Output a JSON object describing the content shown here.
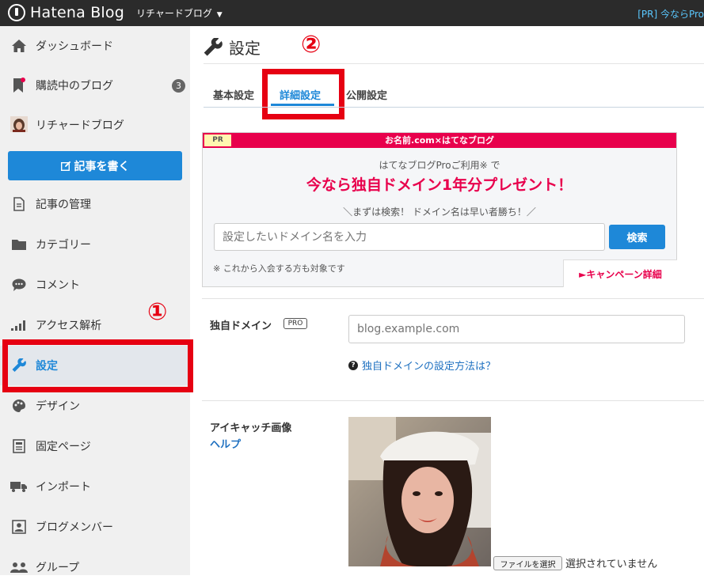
{
  "header": {
    "logo_text": "Hatena Blog",
    "blog_switch": "リチャードブログ",
    "pr_text": "[PR] 今ならPro"
  },
  "sidebar": {
    "items": [
      {
        "label": "ダッシュボード",
        "icon": "home-icon"
      },
      {
        "label": "購読中のブログ",
        "icon": "bookmark-icon",
        "badge": "3"
      },
      {
        "label": "リチャードブログ",
        "icon": "avatar"
      },
      {
        "label": "記事の管理",
        "icon": "document-icon"
      },
      {
        "label": "カテゴリー",
        "icon": "folder-icon"
      },
      {
        "label": "コメント",
        "icon": "comment-icon"
      },
      {
        "label": "アクセス解析",
        "icon": "signal-icon"
      },
      {
        "label": "設定",
        "icon": "wrench-icon"
      },
      {
        "label": "デザイン",
        "icon": "palette-icon"
      },
      {
        "label": "固定ページ",
        "icon": "page-icon"
      },
      {
        "label": "インポート",
        "icon": "truck-icon"
      },
      {
        "label": "ブログメンバー",
        "icon": "member-icon"
      },
      {
        "label": "グループ",
        "icon": "group-icon"
      }
    ],
    "write_button": "記事を書く"
  },
  "annotations": {
    "marker1": "①",
    "marker2": "②"
  },
  "main": {
    "title": "設定",
    "tabs": [
      {
        "label": "基本設定"
      },
      {
        "label": "詳細設定",
        "active": true
      },
      {
        "label": "公開設定"
      }
    ],
    "pr": {
      "tag": "PR",
      "header": "お名前.com×はてなブログ",
      "sub": "はてなブログProご利用※ で",
      "headline": "今なら独自ドメイン1年分プレゼント！",
      "catch": "＼まずは検索！ ドメイン名は早い者勝ち！／",
      "input_placeholder": "設定したいドメイン名を入力",
      "search_button": "検索",
      "note": "※ これから入会する方も対象です",
      "campaign_button": "►キャンペーン詳細"
    },
    "custom_domain": {
      "label": "独自ドメイン",
      "badge": "PRO",
      "placeholder": "blog.example.com",
      "help_link": "独自ドメインの設定方法は？"
    },
    "eyecatch": {
      "label": "アイキャッチ画像",
      "help": "ヘルプ",
      "file_button": "ファイルを選択",
      "file_status": "選択されていません"
    }
  }
}
